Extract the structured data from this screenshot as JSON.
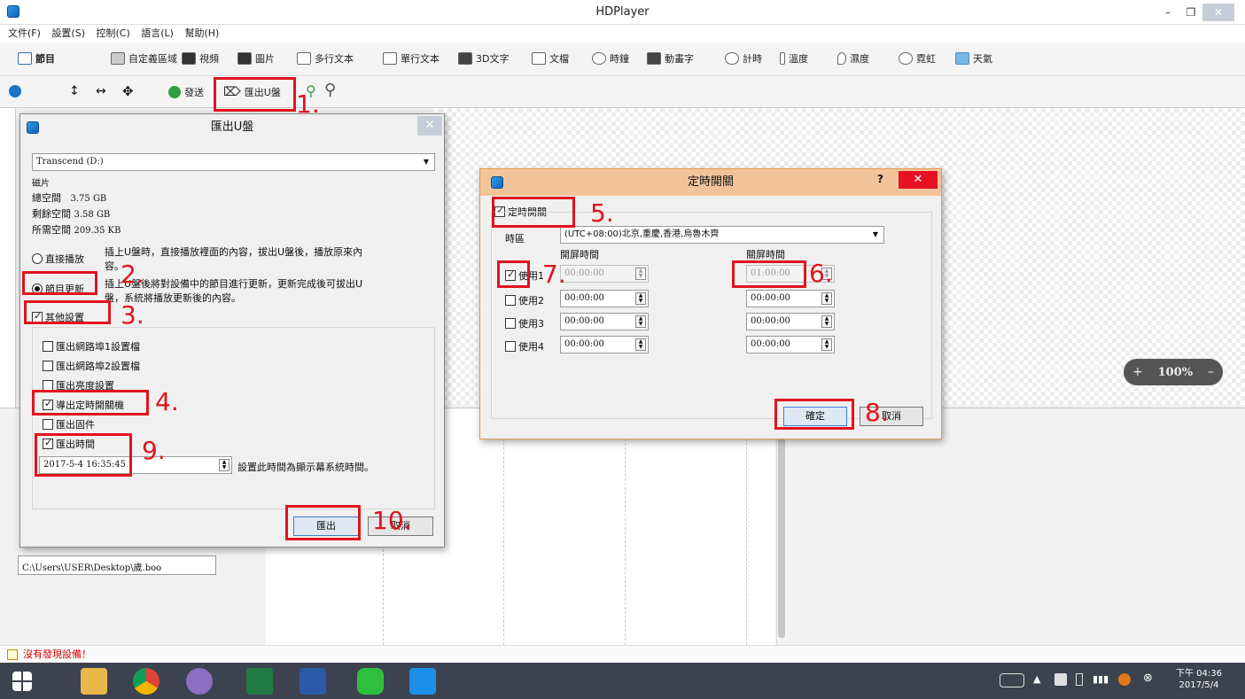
{
  "window": {
    "title": "HDPlayer",
    "minimize": "–",
    "restore": "❐",
    "close": "✕"
  },
  "menu": [
    "文件(F)",
    "設置(S)",
    "控制(C)",
    "語言(L)",
    "幫助(H)"
  ],
  "toolbar1": {
    "program": "節目",
    "items": [
      "自定義區域",
      "視頻",
      "圖片",
      "多行文本",
      "單行文本",
      "3D文字",
      "文檔",
      "時鐘",
      "動畫字",
      "計時",
      "溫度",
      "濕度",
      "霓虹",
      "天氣"
    ]
  },
  "toolbar2": {
    "send": "發送",
    "export_usb": "匯出U盤"
  },
  "export_dialog": {
    "title": "匯出U盤",
    "drive": "Transcend (D:)",
    "disk_label": "磁片",
    "total_label": "總空間",
    "total_value": "3.75 GB",
    "free_label": "剩餘空間",
    "free_value": "3.58 GB",
    "required_label": "所需空間",
    "required_value": "209.35 KB",
    "direct_play": "直接播放",
    "direct_play_desc1": "插上U盤時，直接播放裡面的內容，拔出U盤後，播放原來內",
    "direct_play_desc2": "容。",
    "program_update": "節目更新",
    "program_update_desc1": "插上U盤後將對設備中的節目進行更新，更新完成後可拔出U",
    "program_update_desc2": "盤，系統將播放更新後的內容。",
    "other_settings": "其他設置",
    "opt_net1": "匯出網路埠1設置檔",
    "opt_net2": "匯出網路埠2設置檔",
    "opt_brightness": "匯出亮度設置",
    "opt_timer": "導出定時開關機",
    "opt_firmware": "匯出固件",
    "opt_time": "匯出時間",
    "time_value": "2017-5-4 16:35:45",
    "time_desc": "設置此時間為顯示幕系統時間。",
    "export_btn": "匯出",
    "cancel_btn": "取消"
  },
  "timer_dialog": {
    "title": "定時開關",
    "help": "?",
    "enable": "定時開關",
    "timezone_label": "時區",
    "timezone": "(UTC+08:00)北京,重慶,香港,烏魯木齊",
    "on_header": "開屏時間",
    "off_header": "關屏時間",
    "rows": [
      {
        "label": "使用1",
        "on": "00:00:00",
        "off": "01:00:00"
      },
      {
        "label": "使用2",
        "on": "00:00:00",
        "off": "00:00:00"
      },
      {
        "label": "使用3",
        "on": "00:00:00",
        "off": "00:00:00"
      },
      {
        "label": "使用4",
        "on": "00:00:00",
        "off": "00:00:00"
      }
    ],
    "ok_btn": "確定",
    "cancel_btn": "取消"
  },
  "annotations": [
    "1.",
    "2.",
    "3.",
    "4.",
    "5.",
    "6.",
    "7.",
    "8.",
    "9.",
    "10."
  ],
  "zoom": {
    "minus": "–",
    "value": "100%",
    "plus": "+"
  },
  "file_path": "C:\\Users\\USER\\Desktop\\歲.boo",
  "status": "沒有發現設備！",
  "tray": {
    "time": "下午 04:36",
    "date": "2017/5/4"
  },
  "colors": {
    "annotation_red": "#e0141e",
    "close_red": "#e81123",
    "dialog_title_bg": "#f3c49a",
    "taskbar": "#3d4250"
  }
}
